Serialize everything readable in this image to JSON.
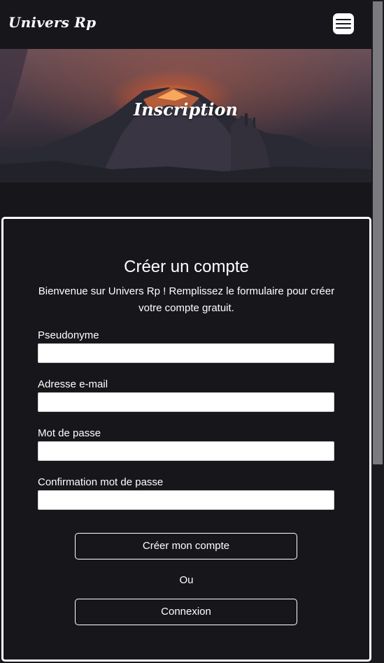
{
  "navbar": {
    "brand": "Univers Rp",
    "menu_icon": "hamburger-menu-icon"
  },
  "hero": {
    "title": "Inscription"
  },
  "form": {
    "title": "Créer un compte",
    "intro": "Bienvenue sur Univers Rp ! Remplissez le formulaire pour créer votre compte gratuit.",
    "fields": [
      {
        "label": "Pseudonyme",
        "value": "",
        "placeholder": ""
      },
      {
        "label": "Adresse e-mail",
        "value": "",
        "placeholder": ""
      },
      {
        "label": "Mot de passe",
        "value": "",
        "placeholder": ""
      },
      {
        "label": "Confirmation mot de passe",
        "value": "",
        "placeholder": ""
      }
    ],
    "submit_label": "Créer mon compte",
    "or_label": "Ou",
    "login_label": "Connexion"
  },
  "colors": {
    "background": "#17161b",
    "text": "#ffffff",
    "border": "#ffffff"
  }
}
